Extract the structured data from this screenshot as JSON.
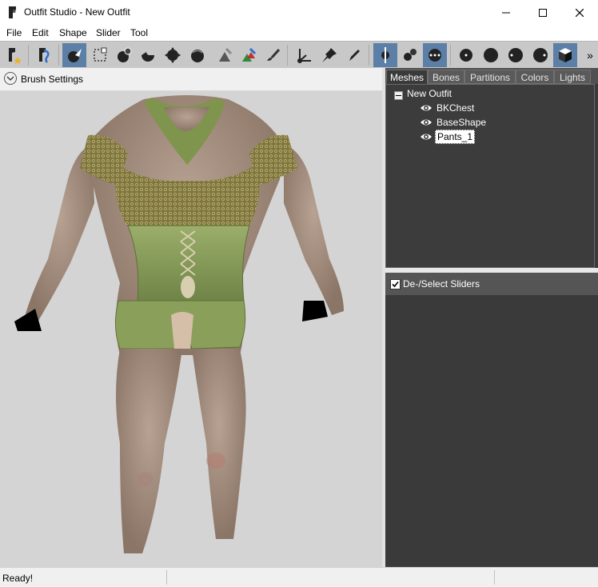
{
  "window": {
    "title": "Outfit Studio - New Outfit"
  },
  "menu": [
    "File",
    "Edit",
    "Shape",
    "Slider",
    "Tool"
  ],
  "toolbar": {
    "buttons": [
      {
        "icon": "load-reference-icon"
      },
      {
        "icon": "load-outfit-icon"
      },
      {
        "icon": "select-brush-icon",
        "active": true
      },
      {
        "icon": "mask-brush-icon"
      },
      {
        "icon": "inflate-brush-icon"
      },
      {
        "icon": "deflate-brush-icon"
      },
      {
        "icon": "move-brush-icon"
      },
      {
        "icon": "smooth-brush-icon"
      },
      {
        "icon": "undiff-brush-icon"
      },
      {
        "icon": "weight-brush-icon"
      },
      {
        "icon": "color-brush-icon"
      },
      {
        "icon": "transform-icon"
      },
      {
        "icon": "pivot-icon"
      },
      {
        "icon": "vertex-edit-icon"
      },
      {
        "icon": "mirror-x-icon",
        "active": true
      },
      {
        "icon": "connected-only-icon"
      },
      {
        "icon": "global-brush-icon",
        "active": true
      },
      {
        "icon": "brush-size-1-icon"
      },
      {
        "icon": "brush-size-2-icon"
      },
      {
        "icon": "brush-size-3-icon"
      },
      {
        "icon": "brush-size-4-icon"
      },
      {
        "icon": "wireframe-icon",
        "active": true
      }
    ],
    "overflow": "»"
  },
  "brush": {
    "label": "Brush Settings"
  },
  "tabs": [
    "Meshes",
    "Bones",
    "Partitions",
    "Colors",
    "Lights"
  ],
  "active_tab": "Meshes",
  "tree": {
    "root": "New Outfit",
    "items": [
      {
        "label": "BKChest",
        "selected": false
      },
      {
        "label": "BaseShape",
        "selected": false
      },
      {
        "label": "Pants_1",
        "selected": true
      }
    ]
  },
  "sliders": {
    "label": "De-/Select Sliders",
    "checked": true
  },
  "status": {
    "text": "Ready!"
  }
}
